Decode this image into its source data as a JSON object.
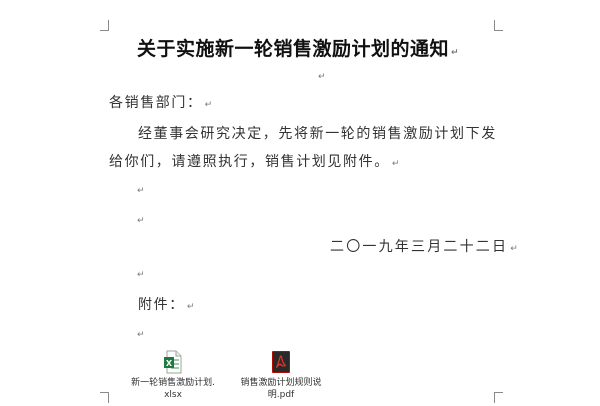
{
  "document": {
    "title": "关于实施新一轮销售激励计划的通知",
    "paragraph_mark": "↵",
    "salutation": "各销售部门：",
    "body_line1": "经董事会研究决定，先将新一轮的销售激励计划下发",
    "body_line2": "给你们，请遵照执行，销售计划见附件。",
    "date": "二〇一九年三月二十二日",
    "attachments_label": "附件："
  },
  "attachments": [
    {
      "name": "新一轮销售激励计划.xlsx",
      "type": "excel",
      "icon": "excel-file-icon",
      "icon_color": "#1d7a43"
    },
    {
      "name": "销售激励计划规则说明.pdf",
      "type": "pdf",
      "icon": "pdf-file-icon",
      "icon_color": "#b30b00"
    }
  ]
}
